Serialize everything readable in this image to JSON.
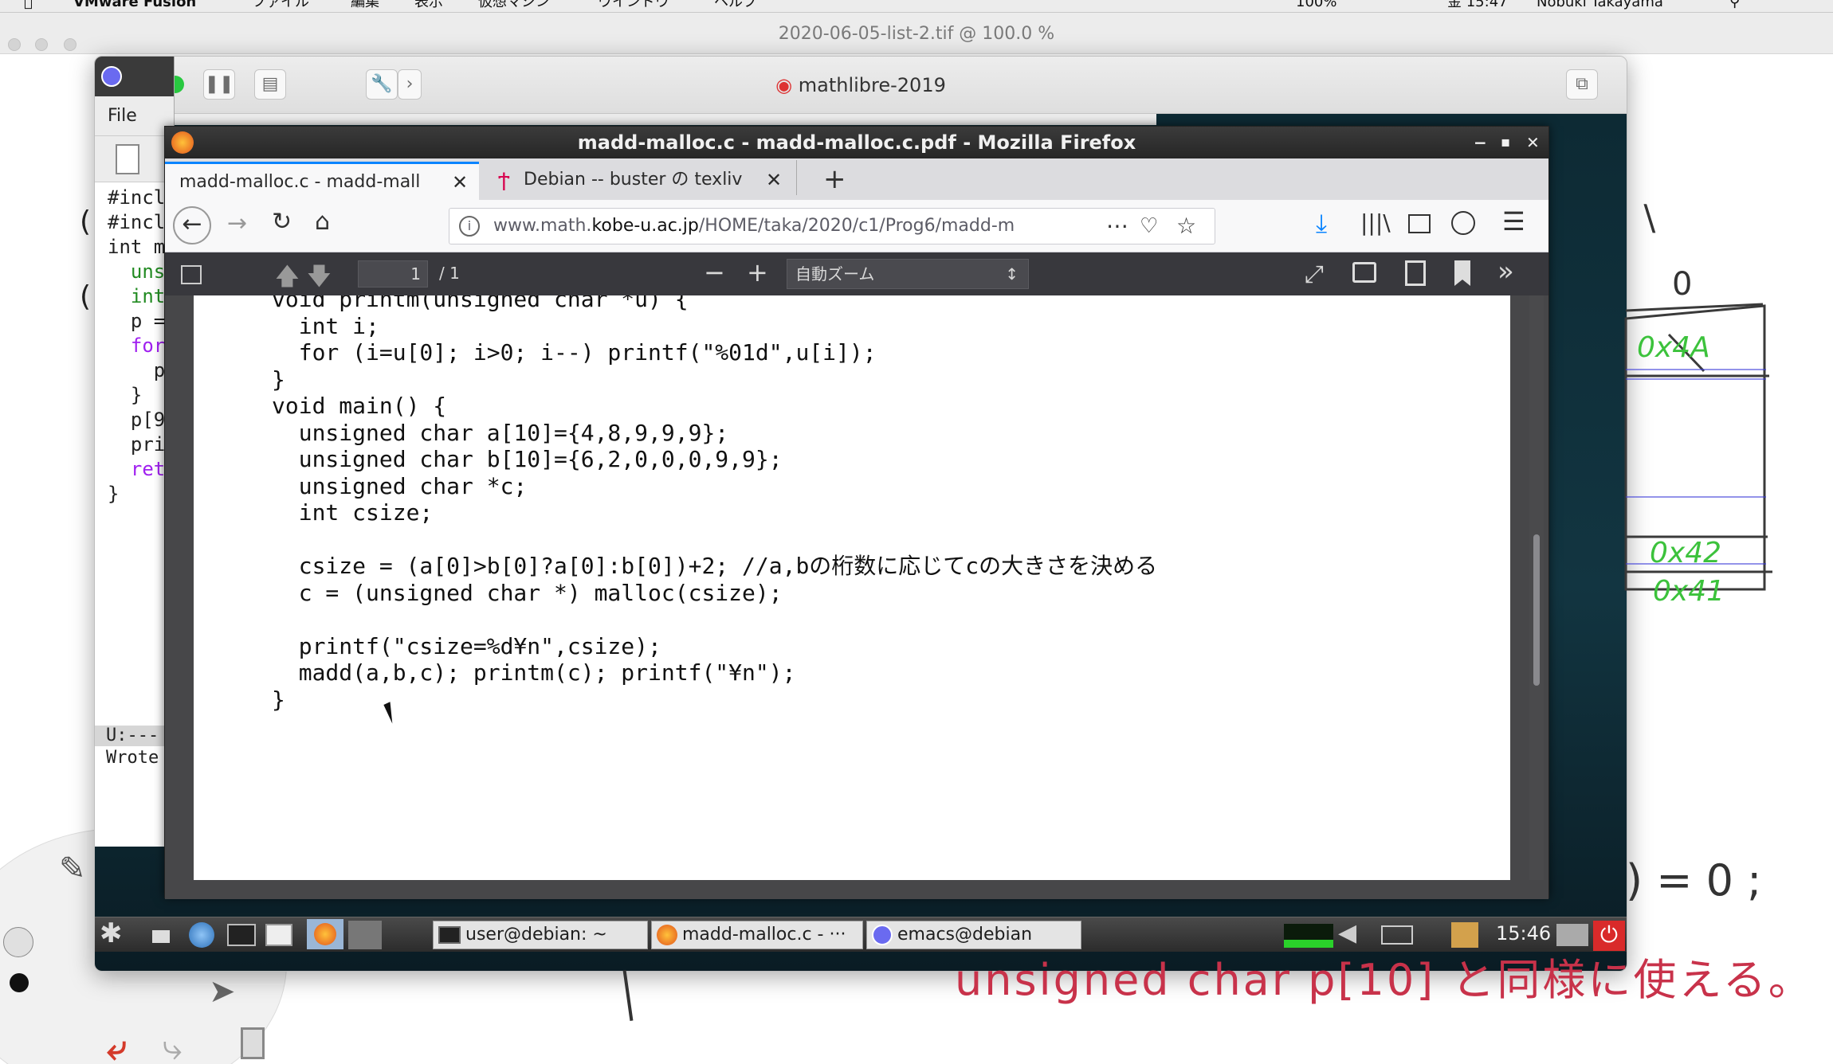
{
  "menubar": {
    "app_name": "VMware Fusion",
    "menus": [
      "ファイル",
      "編集",
      "表示",
      "仮想マシン",
      "ウインドウ",
      "ヘルプ"
    ],
    "battery": "100%",
    "clock": "金 15:47",
    "user": "Nobuki Takayama"
  },
  "viewer": {
    "title": "2020-06-05-list-2.tif @ 100.0 %"
  },
  "vmware": {
    "title": "mathlibre-2019"
  },
  "emacs": {
    "menu_file": "File",
    "code_lines": [
      "#incl",
      "#incl",
      "int m",
      "  uns",
      "  int",
      "  p =",
      "  for",
      "    p",
      "  }",
      "  p[9",
      "  pri",
      "  ret",
      "}"
    ],
    "mode_line": "U:---",
    "echo": "Wrote"
  },
  "firefox": {
    "window_title": "madd-malloc.c - madd-malloc.c.pdf - Mozilla Firefox",
    "tabs": [
      {
        "label": "madd-malloc.c - madd-mall"
      },
      {
        "label": "Debian -- buster の texliv"
      }
    ],
    "url": {
      "prefix": "www.math.",
      "domain": "kobe-u.ac.jp",
      "path": "/HOME/taka/2020/c1/Prog6/madd-m"
    },
    "pdf": {
      "page_current": "1",
      "page_total": "/ 1",
      "zoom": "自動ズーム",
      "code_lines": [
        "void printm(unsigned char *u) {",
        "  int i;",
        "  for (i=u[0]; i>0; i--) printf(\"%01d\",u[i]);",
        "}",
        "void main() {",
        "  unsigned char a[10]={4,8,9,9,9};",
        "  unsigned char b[10]={6,2,0,0,0,9,9};",
        "  unsigned char *c;",
        "  int csize;",
        "",
        "  csize = (a[0]>b[0]?a[0]:b[0])+2; //a,bの桁数に応じてcの大きさを決める",
        "  c = (unsigned char *) malloc(csize);",
        "",
        "  printf(\"csize=%d¥n\",csize);",
        "  madd(a,b,c); printm(c); printf(\"¥n\");",
        "}"
      ]
    }
  },
  "taskbar": {
    "items": [
      "user@debian: ~",
      "madd-malloc.c - ···",
      "emacs@debian"
    ],
    "clock": "15:46"
  },
  "annotations": {
    "memory_cells": [
      "0x4A",
      "0x42",
      "0x41"
    ],
    "zero": "0",
    "assign": ") = 0 ;",
    "bottom_text": "unsigned char p[10] と同様に使える。"
  },
  "colors": {
    "annotation_green": "#3cc23c",
    "annotation_blue": "#3a3ad8",
    "annotation_red": "#c8324a",
    "firefox_accent": "#0a84ff"
  }
}
